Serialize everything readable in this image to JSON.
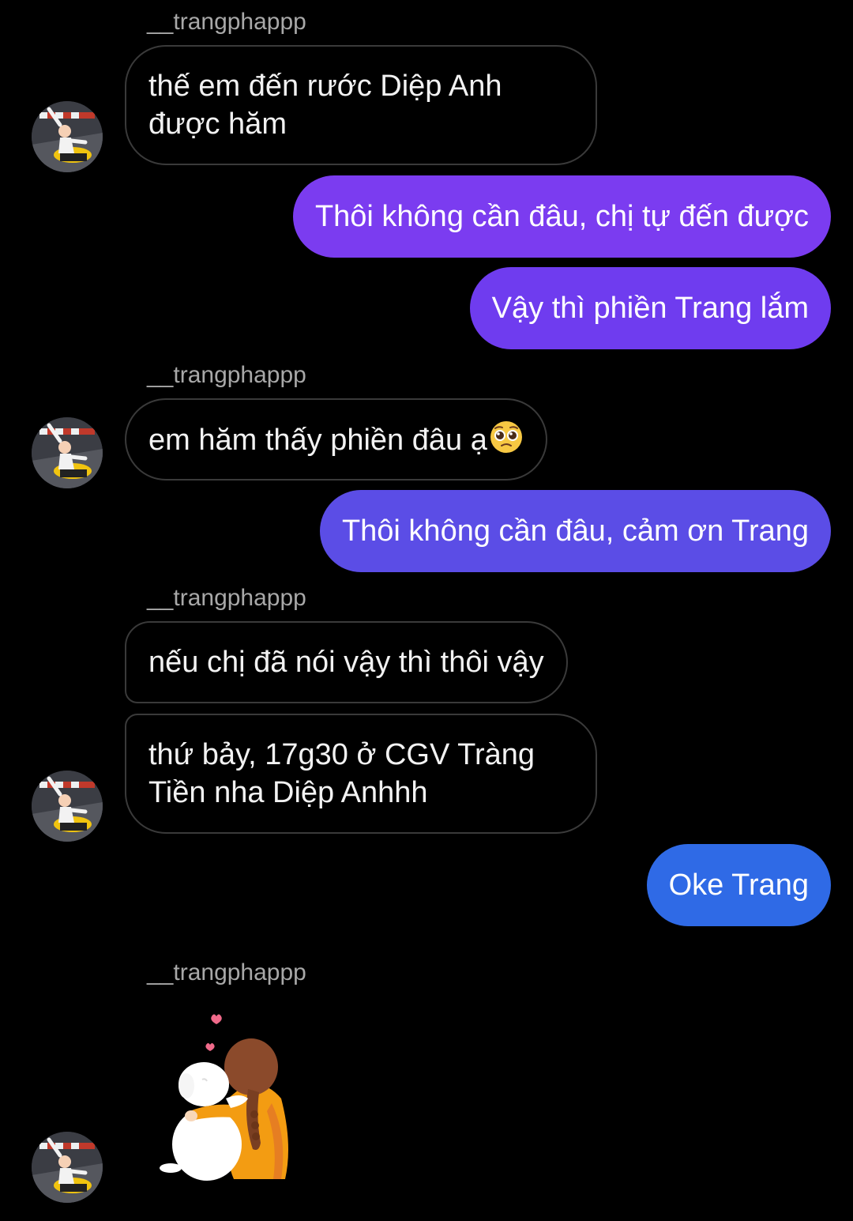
{
  "conversation": {
    "sender": "__trangphappp",
    "messages": [
      {
        "from": "them",
        "lines": [
          "thế em đến rước Diệp Anh",
          "được hăm"
        ]
      },
      {
        "from": "me",
        "text": "Thôi không cần đâu, chị tự đến được"
      },
      {
        "from": "me",
        "text": "Vậy thì phiền Trang lắm"
      },
      {
        "from": "them",
        "text": "em hăm thấy phiền đâu ạ",
        "emoji": "pleading-face-emoji"
      },
      {
        "from": "me",
        "text": "Thôi không cần đâu, cảm ơn Trang"
      },
      {
        "from": "them",
        "text": "nếu chị đã nói vậy thì thôi vậy"
      },
      {
        "from": "them",
        "lines": [
          "thứ bảy, 17g30 ở CGV Tràng",
          "Tiền nha Diệp Anhhh"
        ]
      },
      {
        "from": "me",
        "text": "Oke Trang"
      },
      {
        "from": "them",
        "sticker": "girl-hugging-dog-sticker"
      }
    ]
  },
  "colors": {
    "background": "#000000",
    "incoming_border": "#3a3a3a",
    "outgoing_purple": "#7b3cf0",
    "outgoing_indigo": "#5b4de6",
    "outgoing_blue": "#2f6ae6",
    "sender_name": "#a8a8a8"
  },
  "icons": {
    "avatar": "profile-avatar",
    "emoji": "pleading-face-emoji",
    "sticker": "girl-hugging-dog-sticker"
  }
}
